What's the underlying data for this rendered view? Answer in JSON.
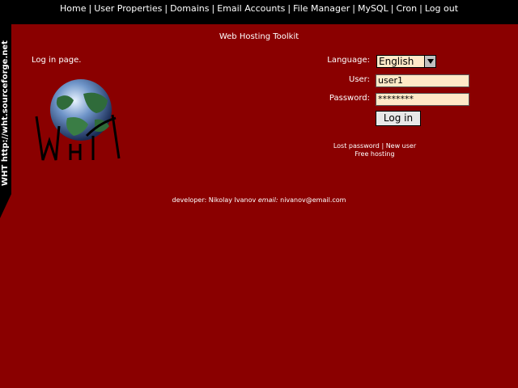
{
  "nav": {
    "items": [
      "Home",
      "User Properties",
      "Domains",
      "Email Accounts",
      "File Manager",
      "MySQL",
      "Cron",
      "Log out"
    ]
  },
  "sidebar": {
    "text": "WHT  http://wht.sourceforge.net"
  },
  "page": {
    "title": "Web Hosting Toolkit",
    "intro": "Log in page."
  },
  "logo": {
    "text": "WHT"
  },
  "form": {
    "language_label": "Language:",
    "language_value": "English",
    "user_label": "User:",
    "user_value": "user1",
    "password_label": "Password:",
    "password_value": "********",
    "login_button": "Log in"
  },
  "links": {
    "lost_password": "Lost password",
    "separator": "|",
    "new_user": "New user",
    "free_hosting": "Free hosting"
  },
  "footer": {
    "developer_text": "developer: Nikolay Ivanov",
    "email_label": "email:",
    "email_value": "nivanov@email.com"
  },
  "colors": {
    "background": "#8a0000",
    "topbar": "#000000",
    "input_bg": "#ffe9c8"
  }
}
